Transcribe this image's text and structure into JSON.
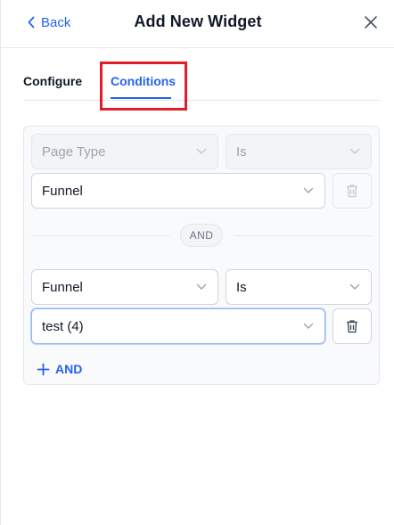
{
  "header": {
    "back_label": "Back",
    "title": "Add New Widget",
    "close_icon": "close-icon"
  },
  "tabs": [
    {
      "label": "Configure",
      "active": false
    },
    {
      "label": "Conditions",
      "active": true
    }
  ],
  "colors": {
    "accent": "#2563eb",
    "highlight_box": "#e11d2a",
    "border": "#e5e7eb"
  },
  "conditions": {
    "group1": {
      "row1": {
        "field_placeholder": "Page Type",
        "operator_placeholder": "Is",
        "disabled": true
      },
      "row2": {
        "value": "Funnel",
        "delete_disabled": true
      }
    },
    "separator_label": "AND",
    "group2": {
      "row1": {
        "field": "Funnel",
        "operator": "Is"
      },
      "row2": {
        "value": "test (4)"
      }
    },
    "add_and_label": "AND"
  }
}
